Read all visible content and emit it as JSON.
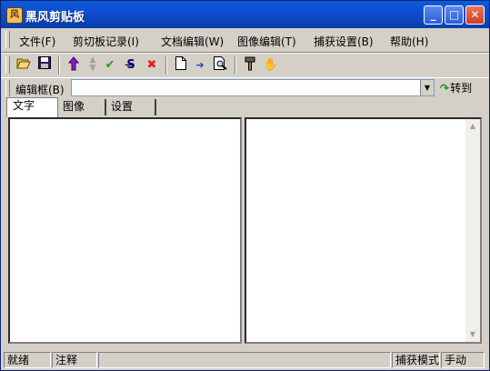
{
  "window": {
    "title": "黑风剪贴板",
    "minimize": "_",
    "maximize": "□",
    "close": "✕"
  },
  "menu": {
    "file": "文件(F)",
    "clip_history": "剪切板记录(I)",
    "doc_edit": "文档编辑(W)",
    "image_edit": "图像编辑(T)",
    "capture_settings": "捕获设置(B)",
    "help": "帮助(H)"
  },
  "toolbar": {
    "icons": [
      "open-folder-icon",
      "save-icon",
      "move-up-icon",
      "spin-updown-icon",
      "check-icon",
      "strikethrough-icon",
      "delete-icon",
      "new-document-icon",
      "arrow-right-icon",
      "print-preview-icon",
      "format-brush-icon",
      "hand-icon"
    ]
  },
  "editbox": {
    "label": "编辑框(B)",
    "value": "",
    "goto_label": "转到"
  },
  "tabs": {
    "text": "文字",
    "image": "图像",
    "settings": "设置"
  },
  "status": {
    "ready": "就绪",
    "note": "注释",
    "capture_mode": "捕获模式",
    "manual": "手动"
  },
  "colors": {
    "title_bar": "#0a4fd0",
    "window_bg": "#d4d0c8",
    "close_button": "#c84028"
  }
}
